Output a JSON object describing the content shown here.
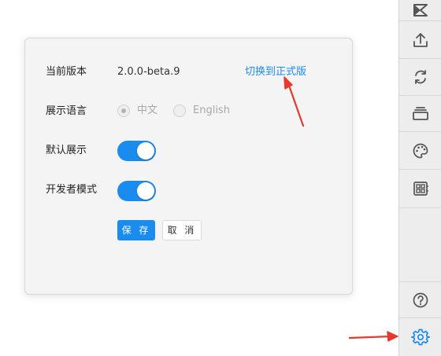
{
  "settings": {
    "version_label": "当前版本",
    "version_value": "2.0.0-beta.9",
    "switch_link": "切换到正式版",
    "language_label": "展示语言",
    "language_options": [
      {
        "label": "中文",
        "checked": true
      },
      {
        "label": "English",
        "checked": false
      }
    ],
    "default_show_label": "默认展示",
    "default_show_on": true,
    "dev_mode_label": "开发者模式",
    "dev_mode_on": true,
    "save_label": "保 存",
    "cancel_label": "取 消"
  },
  "toolbar": {
    "items": [
      {
        "icon": "app-logo-icon"
      },
      {
        "icon": "upload-icon"
      },
      {
        "icon": "refresh-icon"
      },
      {
        "icon": "layers-icon"
      },
      {
        "icon": "palette-icon"
      },
      {
        "icon": "grid-icon"
      },
      {
        "icon": "help-icon"
      },
      {
        "icon": "gear-icon"
      }
    ]
  },
  "colors": {
    "accent": "#1a8cef",
    "annotation_red": "#e53a2d",
    "panel_bg": "#f4f4f4",
    "toolbar_bg": "#ededed",
    "icon_gray": "#555555"
  }
}
